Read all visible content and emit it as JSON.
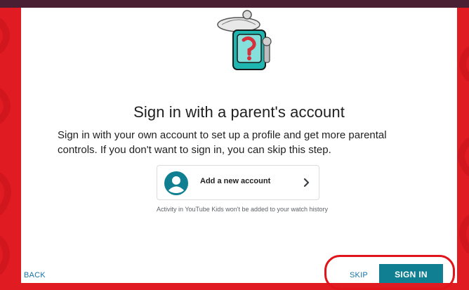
{
  "dialog": {
    "title": "Sign in with a parent's account",
    "description": "Sign in with your own account to set up a profile and get more parental controls. If you don't want to sign in, you can skip this step."
  },
  "account_option": {
    "label": "Add a new account",
    "icon": "account-circle-icon",
    "chevron_icon": "chevron-right-icon"
  },
  "note": "Activity in YouTube Kids won't be added to your watch history",
  "buttons": {
    "back": "BACK",
    "skip": "SKIP",
    "sign_in": "SIGN IN"
  },
  "colors": {
    "background_red": "#e11b22",
    "topbar": "#4a1f33",
    "accent_teal": "#0f7f91",
    "link_blue": "#1773a8",
    "highlight_red": "#e0141a"
  }
}
